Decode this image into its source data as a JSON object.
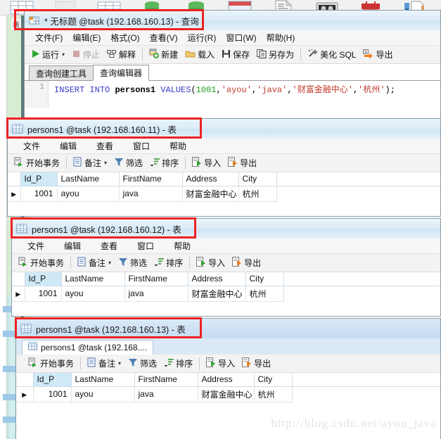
{
  "background": {
    "left_label": "表",
    "icons": [
      "table-grid-icon",
      "blank-icon",
      "table-grid-icon",
      "database-green-icon",
      "database-green-icon",
      "table-blue-icon",
      "document-lines-icon",
      "film-tape-icon",
      "red-building-icon",
      "tools-icon"
    ]
  },
  "query_window": {
    "title": "* 无标题 @task (192.168.160.13) - 查询",
    "title_icon": "query-window-icon",
    "menu": [
      {
        "label": "文件(F)"
      },
      {
        "label": "编辑(E)"
      },
      {
        "label": "格式(O)"
      },
      {
        "label": "查看(V)"
      },
      {
        "label": "运行(R)"
      },
      {
        "label": "窗口(W)"
      },
      {
        "label": "帮助(H)"
      }
    ],
    "toolbar": [
      {
        "label": "运行",
        "icon": "play-icon",
        "disabled": false,
        "caret": true
      },
      {
        "label": "停止",
        "icon": "stop-icon",
        "disabled": true,
        "caret": false
      },
      {
        "label": "解释",
        "icon": "explain-icon",
        "disabled": false,
        "caret": false
      },
      {
        "label": "新建",
        "icon": "new-icon",
        "disabled": false,
        "caret": false
      },
      {
        "label": "载入",
        "icon": "folder-open-icon",
        "disabled": false,
        "caret": false
      },
      {
        "label": "保存",
        "icon": "save-disk-icon",
        "disabled": false,
        "caret": false
      },
      {
        "label": "另存为",
        "icon": "save-as-icon",
        "disabled": false,
        "caret": false
      },
      {
        "label": "美化 SQL",
        "icon": "beautify-wand-icon",
        "disabled": false,
        "caret": false
      },
      {
        "label": "导出",
        "icon": "export-arrow-icon",
        "disabled": false,
        "caret": false
      }
    ],
    "tabs": [
      {
        "label": "查询创建工具",
        "active": false
      },
      {
        "label": "查询编辑器",
        "active": true
      }
    ],
    "editor": {
      "line_number": "1",
      "sql_tokens": [
        {
          "t": "INSERT",
          "c": "kw"
        },
        {
          "t": " ",
          "c": "pn"
        },
        {
          "t": "INTO",
          "c": "kw"
        },
        {
          "t": " ",
          "c": "pn"
        },
        {
          "t": "persons1",
          "c": "ident"
        },
        {
          "t": " ",
          "c": "pn"
        },
        {
          "t": "VALUES",
          "c": "kw"
        },
        {
          "t": "(",
          "c": "pn"
        },
        {
          "t": "1001",
          "c": "num"
        },
        {
          "t": ",",
          "c": "pn"
        },
        {
          "t": "'ayou'",
          "c": "str"
        },
        {
          "t": ",",
          "c": "pn"
        },
        {
          "t": "'java'",
          "c": "str"
        },
        {
          "t": ",",
          "c": "pn"
        },
        {
          "t": "'财富金融中心'",
          "c": "str"
        },
        {
          "t": ",",
          "c": "pn"
        },
        {
          "t": "'杭州'",
          "c": "str"
        },
        {
          "t": ");",
          "c": "pn"
        }
      ]
    }
  },
  "table_window_common": {
    "menu": [
      {
        "label": "文件"
      },
      {
        "label": "编辑"
      },
      {
        "label": "查看"
      },
      {
        "label": "窗口"
      },
      {
        "label": "帮助"
      }
    ],
    "toolbar": [
      {
        "label": "开始事务",
        "icon": "begin-transaction-icon",
        "caret": false
      },
      {
        "label": "备注",
        "icon": "note-icon",
        "caret": true
      },
      {
        "label": "筛选",
        "icon": "filter-funnel-icon",
        "caret": false
      },
      {
        "label": "排序",
        "icon": "sort-icon",
        "caret": false
      },
      {
        "label": "导入",
        "icon": "import-icon",
        "caret": false
      },
      {
        "label": "导出",
        "icon": "export-icon",
        "caret": false
      }
    ],
    "columns": [
      "Id_P",
      "LastName",
      "FirstName",
      "Address",
      "City"
    ],
    "rows": [
      {
        "Id_P": "1001",
        "LastName": "ayou",
        "FirstName": "java",
        "Address": "财富金融中心",
        "City": "杭州"
      }
    ],
    "row_marker": "▶"
  },
  "table_windows": [
    {
      "title": "persons1 @task (192.168.160.11) - 表",
      "title_icon": "table-window-icon",
      "has_tab": false
    },
    {
      "title": "persons1 @task (192.168.160.12) - 表",
      "title_icon": "table-window-icon",
      "has_tab": false
    },
    {
      "title": "persons1 @task (192.168.160.13) - 表",
      "title_icon": "table-window-icon",
      "has_tab": true,
      "tab_label": "persons1 @task (192.168....",
      "tab_icon": "table-window-icon"
    }
  ],
  "annotations": {
    "highlight_color": "#ee2222",
    "boxes": 4
  },
  "watermark": "http://blog.csdn.net/ayou_java"
}
